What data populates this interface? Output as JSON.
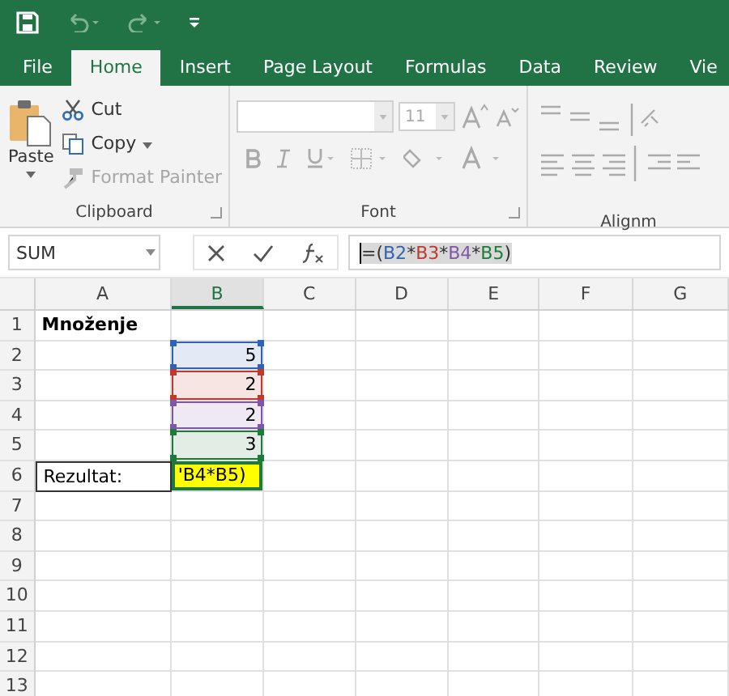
{
  "tabs": [
    {
      "label": "File",
      "selected": false
    },
    {
      "label": "Home",
      "selected": true
    },
    {
      "label": "Insert",
      "selected": false
    },
    {
      "label": "Page Layout",
      "selected": false
    },
    {
      "label": "Formulas",
      "selected": false
    },
    {
      "label": "Data",
      "selected": false
    },
    {
      "label": "Review",
      "selected": false
    },
    {
      "label": "Vie",
      "selected": false
    }
  ],
  "clipboard": {
    "label": "Clipboard",
    "paste": "Paste",
    "items": [
      {
        "kind": "cut",
        "label": "Cut",
        "disabled": false
      },
      {
        "kind": "copy",
        "label": "Copy",
        "disabled": false
      },
      {
        "kind": "painter",
        "label": "Format Painter",
        "disabled": true
      }
    ]
  },
  "font": {
    "label": "Font",
    "size": "11"
  },
  "alignment": {
    "label": "Alignm"
  },
  "name_box": "SUM",
  "formula": [
    {
      "text": "=("
    },
    {
      "text": "B2",
      "color": "#2f64b4"
    },
    {
      "text": "*"
    },
    {
      "text": "B3",
      "color": "#c0392b"
    },
    {
      "text": "*"
    },
    {
      "text": "B4",
      "color": "#7e57a8"
    },
    {
      "text": "*"
    },
    {
      "text": "B5",
      "color": "#1f7a3a"
    },
    {
      "text": ")"
    }
  ],
  "columns": [
    {
      "label": "A",
      "selected": false
    },
    {
      "label": "B",
      "selected": true
    },
    {
      "label": "C",
      "selected": false
    },
    {
      "label": "D",
      "selected": false
    },
    {
      "label": "E",
      "selected": false
    },
    {
      "label": "F",
      "selected": false
    },
    {
      "label": "G",
      "selected": false
    }
  ],
  "rows": [
    {
      "label": "1",
      "a": {
        "text": "Množenje",
        "bold": true
      }
    },
    {
      "label": "2",
      "b": {
        "text": "5",
        "color": "#2f64b4"
      }
    },
    {
      "label": "3",
      "b": {
        "text": "2",
        "color": "#c0392b"
      }
    },
    {
      "label": "4",
      "b": {
        "text": "2",
        "color": "#7e57a8"
      }
    },
    {
      "label": "5",
      "b": {
        "text": "3",
        "color": "#1f7a3a"
      }
    },
    {
      "label": "6",
      "a": {
        "text": "Rezultat:",
        "bold": false
      },
      "b": {
        "text": "'B4*B5)",
        "kind": "editing"
      }
    },
    {
      "label": "7"
    },
    {
      "label": "8"
    },
    {
      "label": "9"
    },
    {
      "label": "10"
    },
    {
      "label": "11"
    },
    {
      "label": "12"
    },
    {
      "label": "13"
    }
  ]
}
